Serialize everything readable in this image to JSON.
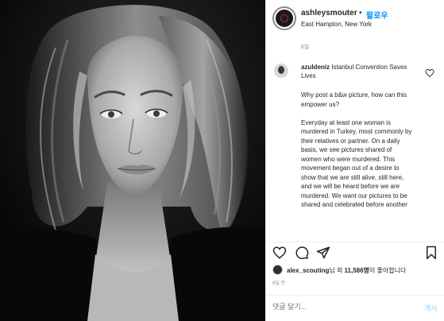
{
  "header": {
    "username": "ashleysmouter",
    "separator": "•",
    "follow_label": "팔로우",
    "location": "East Hampton, New York"
  },
  "post": {
    "time_top": "6일"
  },
  "comment": {
    "username": "azuldeniz",
    "title": "Istanbul Convention Saves Lives",
    "paragraphs": [
      "Why post a b&w picture, how can this empower us?",
      "Everyday at least one woman is murdered in Turkey, most commonly by their relatives or partner. On a daily basis, we see pictures shared of women who were murdered. This movement began out of a desire to show that we are still alive, still here, and we will be heard before we are murdered. We want our pictures to be shared and celebrated before another"
    ]
  },
  "actions": {
    "like": "heart-icon",
    "comment": "comment-bubble-icon",
    "share": "paper-plane-icon",
    "save": "bookmark-icon"
  },
  "likes": {
    "user": "alex_scouting",
    "middle": "님 외 ",
    "count": "11,586명",
    "suffix": "이 좋아합니다"
  },
  "time_bottom": "6일 전",
  "comment_input": {
    "placeholder": "댓글 달기...",
    "post_label": "게시"
  },
  "colors": {
    "accent": "#0095f6",
    "post_disabled": "#b2dffc",
    "muted": "#8e8e8e"
  }
}
